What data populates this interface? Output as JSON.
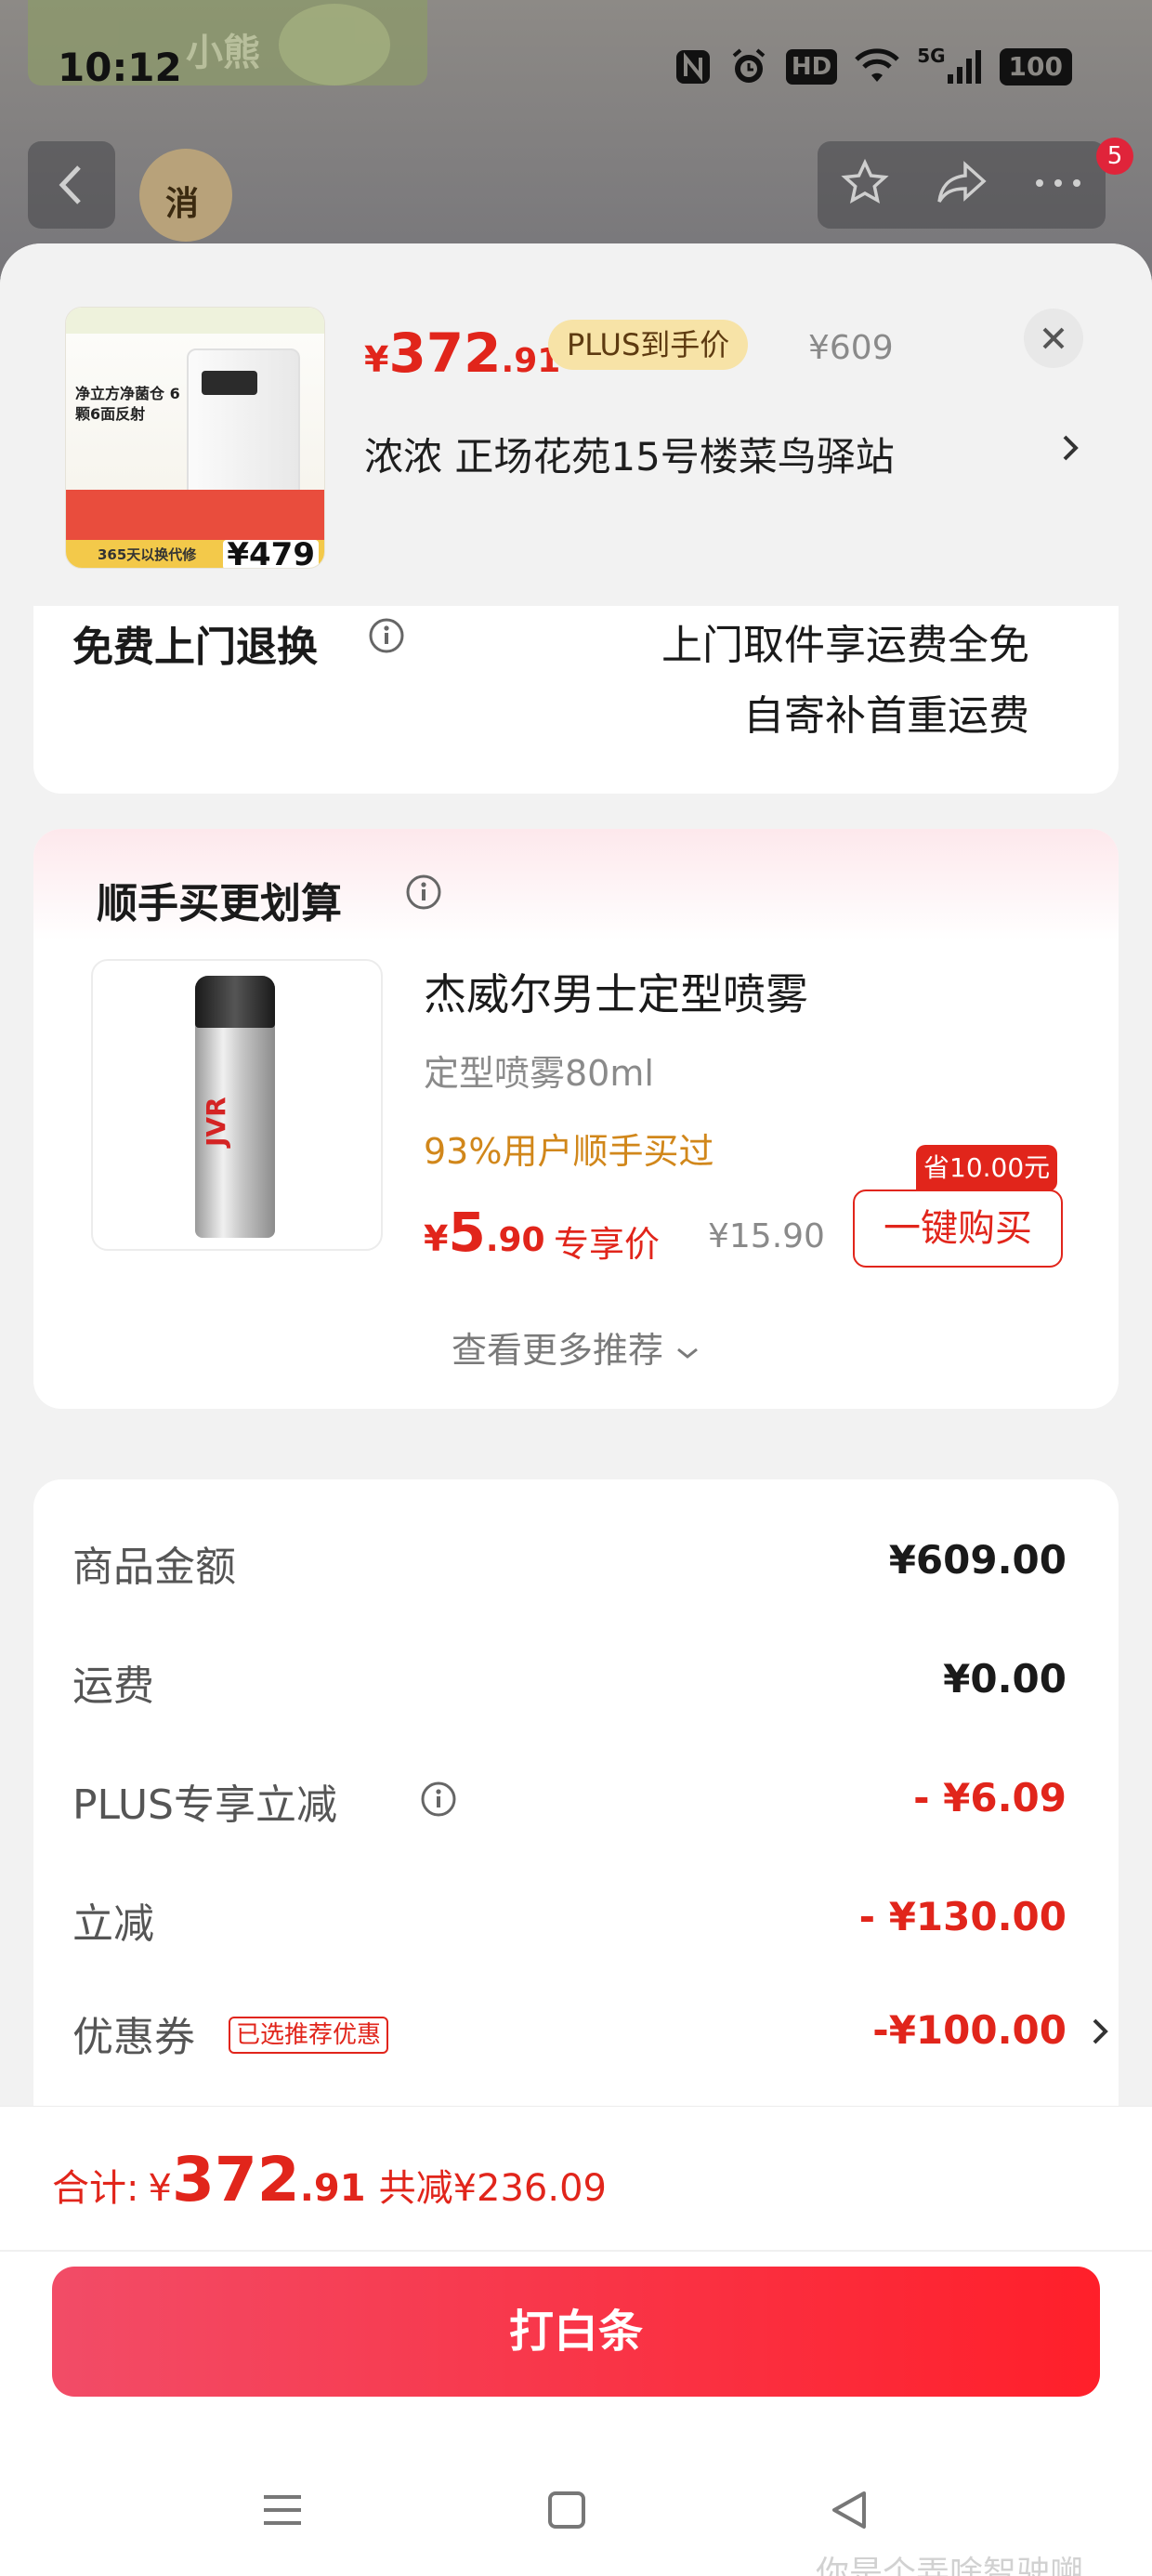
{
  "status_bar": {
    "time": "10:12",
    "icons": [
      "nfc-icon",
      "alarm-icon",
      "hd-icon",
      "wifi-icon",
      "5g-signal-icon",
      "battery-icon"
    ],
    "hd": "HD",
    "network": "5G",
    "battery": "100"
  },
  "background_page": {
    "brand_text": "小熊",
    "medal_text": "消",
    "cart_badge": "5"
  },
  "sheet": {
    "product_thumb": {
      "headline": "净立方净菌仓 6颗6面反射",
      "strip_text": "365天以换代修",
      "thumb_price": "¥479"
    },
    "price": {
      "currency": "¥",
      "integer": "372",
      "decimal": ".91"
    },
    "plus_tag": "PLUS到手价",
    "original_price": "¥609",
    "address": "浓浓  正场花苑15号楼菜鸟驿站"
  },
  "return_card": {
    "title": "免费上门退换",
    "line1": "上门取件享运费全免",
    "line2": "自寄补首重运费"
  },
  "addon_card": {
    "title": "顺手买更划算",
    "product": {
      "name": "杰威尔男士定型喷雾",
      "spec": "定型喷雾80ml",
      "social_proof": "93%用户顺手买过",
      "price": {
        "currency": "¥",
        "integer": "5",
        "decimal": ".90"
      },
      "exclusive_label": "专享价",
      "original_price": "¥15.90",
      "save_tag": "省10.00元",
      "buy_button": "一键购买",
      "can_text": "JVR"
    },
    "see_more": "查看更多推荐"
  },
  "summary": {
    "rows": [
      {
        "label": "商品金额",
        "value": "¥609.00"
      },
      {
        "label": "运费",
        "value": "¥0.00"
      },
      {
        "label": "PLUS专享立减",
        "value": "- ¥6.09"
      },
      {
        "label": "立减",
        "value": "- ¥130.00"
      },
      {
        "label": "优惠券",
        "tag": "已选推荐优惠",
        "value": "-¥100.00"
      }
    ]
  },
  "bottom_bar": {
    "total_label": "合计:",
    "total": {
      "currency": "¥",
      "integer": "372",
      "decimal": ".91"
    },
    "saved": "共减¥236.09",
    "pay_button": "打白条"
  },
  "watermark": "你是个弄啥智驶嗍",
  "colors": {
    "accent": "#e1251b",
    "pay_gradient_start": "#f24c67",
    "pay_gradient_end": "#ff1f2a",
    "plus_tag_bg": "#f7e3a7",
    "social_proof": "#d1871b"
  }
}
